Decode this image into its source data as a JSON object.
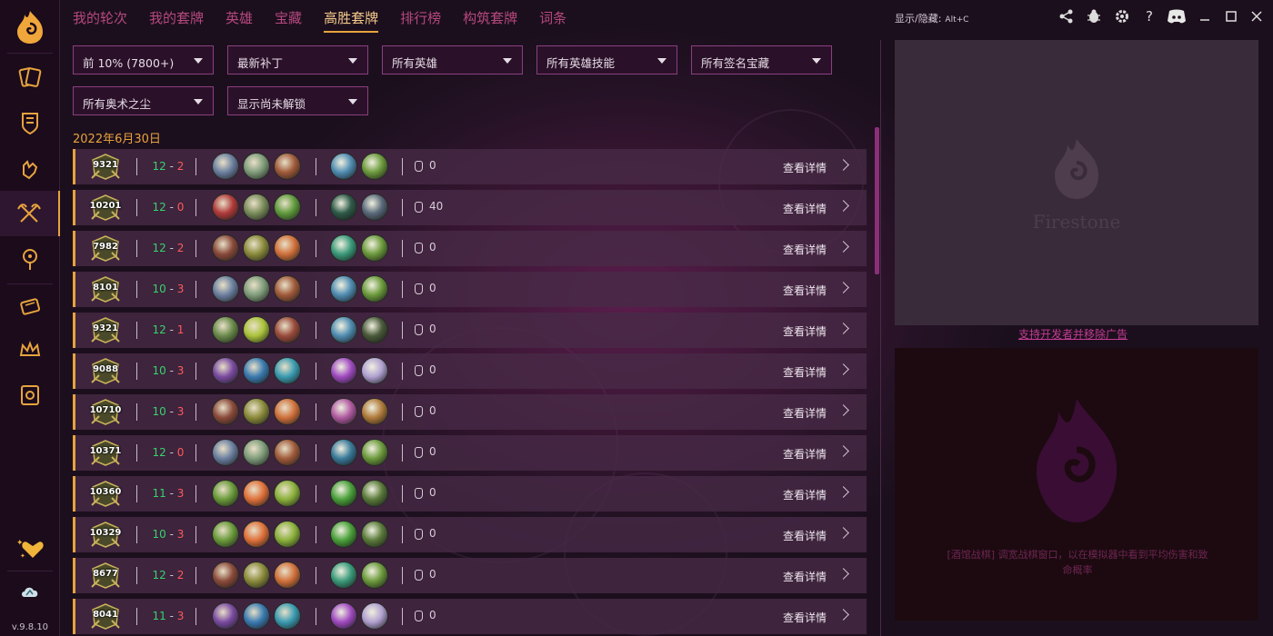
{
  "nav": {
    "tabs": [
      {
        "label": "我的轮次",
        "active": false
      },
      {
        "label": "我的套牌",
        "active": false
      },
      {
        "label": "英雄",
        "active": false
      },
      {
        "label": "宝藏",
        "active": false
      },
      {
        "label": "高胜套牌",
        "active": true
      },
      {
        "label": "排行榜",
        "active": false
      },
      {
        "label": "构筑套牌",
        "active": false
      },
      {
        "label": "词条",
        "active": false
      }
    ]
  },
  "hotkey": {
    "label": "显示/隐藏:",
    "keys": "Alt+C"
  },
  "window_controls": [
    "share-icon",
    "bug-icon",
    "gear-icon",
    "help-icon",
    "discord-icon",
    "minimize-icon",
    "maximize-icon",
    "close-icon"
  ],
  "help_label": "?",
  "sidebar": {
    "items": [
      "logo",
      "cards-icon",
      "shield-deck-icon",
      "hand-icon",
      "crossed-axes-icon",
      "mercenary-icon",
      "ticket-icon",
      "crown-icon",
      "battlegrounds-icon"
    ],
    "active": "crossed-axes-icon",
    "footer_icon": "heart-sparkle-icon",
    "bottom_icon": "cloud-icon",
    "version": "v.9.8.10"
  },
  "filters": [
    {
      "value": "前 10% (7800+)"
    },
    {
      "value": "最新补丁"
    },
    {
      "value": "所有英雄"
    },
    {
      "value": "所有英雄技能"
    },
    {
      "value": "所有签名宝藏"
    },
    {
      "value": "所有奥术之尘"
    },
    {
      "value": "显示尚未解锁"
    }
  ],
  "date_header": "2022年6月30日",
  "rows": [
    {
      "mmr": "9321",
      "wins": "12",
      "losses": "2",
      "dust": "0",
      "detail": "查看详情",
      "heroes": [
        "#6b7fa0",
        "#7f9c7a",
        "#a05a3a"
      ],
      "treasures": [
        "#4f8cb0",
        "#6c9a3c"
      ]
    },
    {
      "mmr": "10201",
      "wins": "12",
      "losses": "0",
      "dust": "40",
      "detail": "查看详情",
      "heroes": [
        "#b03a3a",
        "#7a8c5a",
        "#5f9a3c"
      ],
      "treasures": [
        "#2e5a48",
        "#5a6a7a"
      ]
    },
    {
      "mmr": "7982",
      "wins": "12",
      "losses": "2",
      "dust": "0",
      "detail": "查看详情",
      "heroes": [
        "#8a4a3a",
        "#8a8a3a",
        "#d0703a"
      ],
      "treasures": [
        "#3a9a7a",
        "#6c9a3c"
      ]
    },
    {
      "mmr": "8101",
      "wins": "10",
      "losses": "3",
      "dust": "0",
      "detail": "查看详情",
      "heroes": [
        "#6b7fa0",
        "#7f9c7a",
        "#a05a3a"
      ],
      "treasures": [
        "#4f8cb0",
        "#6c9a3c"
      ]
    },
    {
      "mmr": "9321",
      "wins": "12",
      "losses": "1",
      "dust": "0",
      "detail": "查看详情",
      "heroes": [
        "#6a8a4a",
        "#aac23a",
        "#9a4a3a"
      ],
      "treasures": [
        "#4f8cb0",
        "#4a5a3a"
      ]
    },
    {
      "mmr": "9088",
      "wins": "10",
      "losses": "3",
      "dust": "0",
      "detail": "查看详情",
      "heroes": [
        "#7a4aa0",
        "#3a7ab0",
        "#3a9ab0"
      ],
      "treasures": [
        "#a04ac0",
        "#b0a0d0"
      ]
    },
    {
      "mmr": "10710",
      "wins": "10",
      "losses": "3",
      "dust": "0",
      "detail": "查看详情",
      "heroes": [
        "#8a4a3a",
        "#8a8a3a",
        "#d0703a"
      ],
      "treasures": [
        "#b05aa0",
        "#b07a3a"
      ]
    },
    {
      "mmr": "10371",
      "wins": "12",
      "losses": "0",
      "dust": "0",
      "detail": "查看详情",
      "heroes": [
        "#6b7fa0",
        "#7f9c7a",
        "#a05a3a"
      ],
      "treasures": [
        "#3a7a9a",
        "#6c9a3c"
      ]
    },
    {
      "mmr": "10360",
      "wins": "11",
      "losses": "3",
      "dust": "0",
      "detail": "查看详情",
      "heroes": [
        "#6a9a3a",
        "#e0703a",
        "#8ab03a"
      ],
      "treasures": [
        "#4aa03a",
        "#5a7a3a"
      ]
    },
    {
      "mmr": "10329",
      "wins": "10",
      "losses": "3",
      "dust": "0",
      "detail": "查看详情",
      "heroes": [
        "#6a9a3a",
        "#e0703a",
        "#8ab03a"
      ],
      "treasures": [
        "#4aa03a",
        "#5a7a3a"
      ]
    },
    {
      "mmr": "8677",
      "wins": "12",
      "losses": "2",
      "dust": "0",
      "detail": "查看详情",
      "heroes": [
        "#8a4a3a",
        "#8a8a3a",
        "#d0703a"
      ],
      "treasures": [
        "#3a9a7a",
        "#6c9a3c"
      ]
    },
    {
      "mmr": "8041",
      "wins": "11",
      "losses": "3",
      "dust": "0",
      "detail": "查看详情",
      "heroes": [
        "#7a4aa0",
        "#3a7ab0",
        "#3a9ab0"
      ],
      "treasures": [
        "#a04ac0",
        "#b0a0d0"
      ]
    }
  ],
  "ads": {
    "brand": "Firestone",
    "support_link": "支持开发者并移除广告",
    "promo_text": "[酒馆战棋] 调宽战棋窗口，以在模拟器中看到平均伤害和致命概率"
  },
  "colors": {
    "accent": "#e7a33e",
    "tab_inactive": "#b4487f",
    "win": "#35d36c",
    "loss": "#ff5a5a",
    "dropdown_border": "#8a3f80"
  }
}
